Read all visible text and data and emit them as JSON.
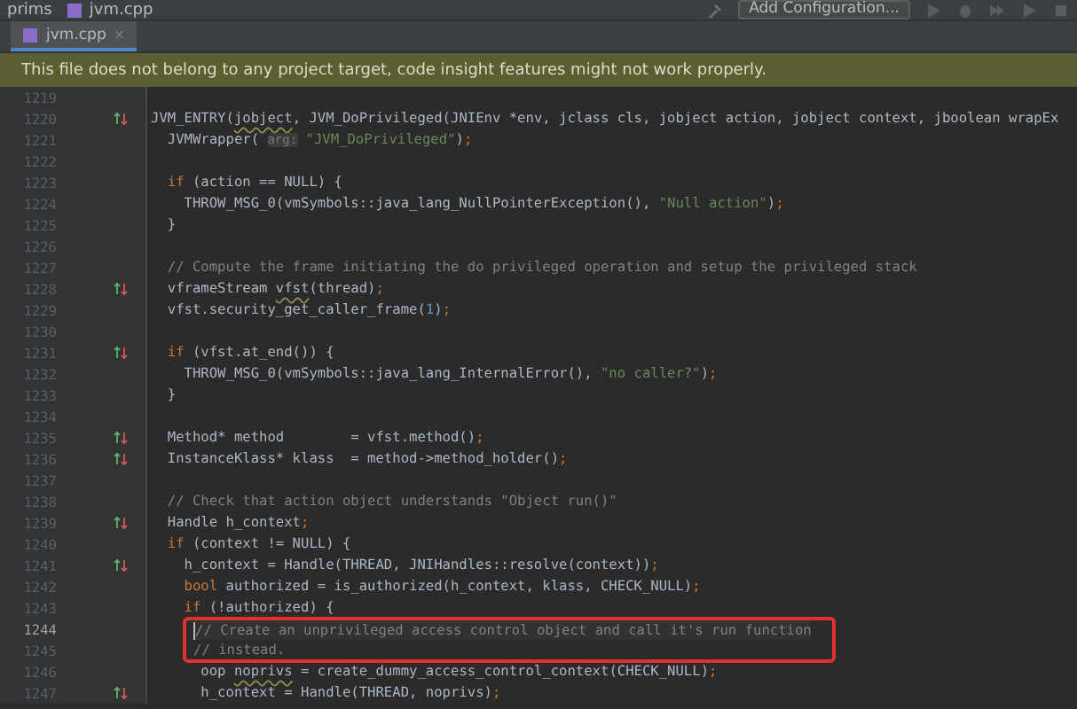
{
  "breadcrumb": [
    "prims",
    "jvm.cpp"
  ],
  "run_config": {
    "label": "Add Configuration..."
  },
  "tabs": [
    {
      "label": "jvm.cpp",
      "close": "×",
      "selected": true
    }
  ],
  "banner": {
    "text": "This file does not belong to any project target, code insight features might not work properly."
  },
  "lines": [
    {
      "number": "1219",
      "gutter_icon": false,
      "current": false,
      "boxed": false
    },
    {
      "number": "1220",
      "gutter_icon": true,
      "current": false,
      "boxed": false,
      "tokens": [
        {
          "kind": "plain",
          "text": "JVM_ENTRY("
        },
        {
          "kind": "warn",
          "text": "jobject"
        },
        {
          "kind": "plain",
          "text": ", JVM_DoPrivileged(JNIEnv *env, jclass cls, jobject action, jobject context, jboolean wrapEx"
        }
      ]
    },
    {
      "number": "1221",
      "gutter_icon": false,
      "current": false,
      "boxed": false,
      "tokens": [
        {
          "kind": "plain",
          "text": "  JVMWrapper( "
        },
        {
          "kind": "hint",
          "text": "arg:"
        },
        {
          "kind": "str",
          "text": " \"JVM_DoPrivileged\""
        },
        {
          "kind": "plain",
          "text": ")"
        },
        {
          "kind": "punct",
          "text": ";"
        }
      ]
    },
    {
      "number": "1222",
      "gutter_icon": false,
      "current": false,
      "boxed": false
    },
    {
      "number": "1223",
      "gutter_icon": false,
      "current": false,
      "boxed": false,
      "tokens": [
        {
          "kind": "kw",
          "text": "  if"
        },
        {
          "kind": "plain",
          "text": " (action == NULL) {"
        }
      ]
    },
    {
      "number": "1224",
      "gutter_icon": false,
      "current": false,
      "boxed": false,
      "tokens": [
        {
          "kind": "plain",
          "text": "    THROW_MSG_0(vmSymbols::java_lang_NullPointerException(), "
        },
        {
          "kind": "str",
          "text": "\"Null action\""
        },
        {
          "kind": "plain",
          "text": ")"
        },
        {
          "kind": "punct",
          "text": ";"
        }
      ]
    },
    {
      "number": "1225",
      "gutter_icon": false,
      "current": false,
      "boxed": false,
      "tokens": [
        {
          "kind": "plain",
          "text": "  }"
        }
      ]
    },
    {
      "number": "1226",
      "gutter_icon": false,
      "current": false,
      "boxed": false
    },
    {
      "number": "1227",
      "gutter_icon": false,
      "current": false,
      "boxed": false,
      "tokens": [
        {
          "kind": "cmt",
          "text": "  // Compute the frame initiating the do privileged operation and setup the privileged stack"
        }
      ]
    },
    {
      "number": "1228",
      "gutter_icon": true,
      "current": false,
      "boxed": false,
      "tokens": [
        {
          "kind": "plain",
          "text": "  vframeStream "
        },
        {
          "kind": "warn",
          "text": "vfst"
        },
        {
          "kind": "plain",
          "text": "(thread)"
        },
        {
          "kind": "punct",
          "text": ";"
        }
      ]
    },
    {
      "number": "1229",
      "gutter_icon": false,
      "current": false,
      "boxed": false,
      "tokens": [
        {
          "kind": "plain",
          "text": "  vfst.security_get_caller_frame("
        },
        {
          "kind": "num",
          "text": "1"
        },
        {
          "kind": "plain",
          "text": ")"
        },
        {
          "kind": "punct",
          "text": ";"
        }
      ]
    },
    {
      "number": "1230",
      "gutter_icon": false,
      "current": false,
      "boxed": false
    },
    {
      "number": "1231",
      "gutter_icon": true,
      "current": false,
      "boxed": false,
      "tokens": [
        {
          "kind": "kw",
          "text": "  if"
        },
        {
          "kind": "plain",
          "text": " (vfst.at_end()) {"
        }
      ]
    },
    {
      "number": "1232",
      "gutter_icon": false,
      "current": false,
      "boxed": false,
      "tokens": [
        {
          "kind": "plain",
          "text": "    THROW_MSG_0(vmSymbols::java_lang_InternalError(), "
        },
        {
          "kind": "str",
          "text": "\"no caller?\""
        },
        {
          "kind": "plain",
          "text": ")"
        },
        {
          "kind": "punct",
          "text": ";"
        }
      ]
    },
    {
      "number": "1233",
      "gutter_icon": false,
      "current": false,
      "boxed": false,
      "tokens": [
        {
          "kind": "plain",
          "text": "  }"
        }
      ]
    },
    {
      "number": "1234",
      "gutter_icon": false,
      "current": false,
      "boxed": false
    },
    {
      "number": "1235",
      "gutter_icon": true,
      "current": false,
      "boxed": false,
      "tokens": [
        {
          "kind": "plain",
          "text": "  Method* method        = vfst.method()"
        },
        {
          "kind": "punct",
          "text": ";"
        }
      ]
    },
    {
      "number": "1236",
      "gutter_icon": true,
      "current": false,
      "boxed": false,
      "tokens": [
        {
          "kind": "plain",
          "text": "  InstanceKlass* klass  = method->method_holder()"
        },
        {
          "kind": "punct",
          "text": ";"
        }
      ]
    },
    {
      "number": "1237",
      "gutter_icon": false,
      "current": false,
      "boxed": false
    },
    {
      "number": "1238",
      "gutter_icon": false,
      "current": false,
      "boxed": false,
      "tokens": [
        {
          "kind": "cmt",
          "text": "  // Check that action object understands \"Object run()\""
        }
      ]
    },
    {
      "number": "1239",
      "gutter_icon": true,
      "current": false,
      "boxed": false,
      "tokens": [
        {
          "kind": "plain",
          "text": "  Handle h_context"
        },
        {
          "kind": "punct",
          "text": ";"
        }
      ]
    },
    {
      "number": "1240",
      "gutter_icon": false,
      "current": false,
      "boxed": false,
      "tokens": [
        {
          "kind": "kw",
          "text": "  if"
        },
        {
          "kind": "plain",
          "text": " (context != NULL) {"
        }
      ]
    },
    {
      "number": "1241",
      "gutter_icon": true,
      "current": false,
      "boxed": false,
      "tokens": [
        {
          "kind": "plain",
          "text": "    h_context = Handle(THREAD, JNIHandles::resolve(context))"
        },
        {
          "kind": "punct",
          "text": ";"
        }
      ]
    },
    {
      "number": "1242",
      "gutter_icon": false,
      "current": false,
      "boxed": false,
      "tokens": [
        {
          "kind": "kw",
          "text": "    bool"
        },
        {
          "kind": "plain",
          "text": " authorized = is_authorized(h_context, klass, CHECK_NULL)"
        },
        {
          "kind": "punct",
          "text": ";"
        }
      ]
    },
    {
      "number": "1243",
      "gutter_icon": false,
      "current": false,
      "boxed": false,
      "tokens": [
        {
          "kind": "kw",
          "text": "    if"
        },
        {
          "kind": "plain",
          "text": " (!authorized) {"
        }
      ]
    },
    {
      "number": "1244",
      "gutter_icon": false,
      "current": true,
      "boxed": true,
      "tokens": [
        {
          "kind": "cmt",
          "text": "// Create an unprivileged access control object and call it's run function"
        }
      ]
    },
    {
      "number": "1245",
      "gutter_icon": false,
      "current": false,
      "boxed": true,
      "tokens": [
        {
          "kind": "cmt",
          "text": "// instead."
        }
      ]
    },
    {
      "number": "1246",
      "gutter_icon": false,
      "current": false,
      "boxed": false,
      "tokens": [
        {
          "kind": "plain",
          "text": "      oop "
        },
        {
          "kind": "warn",
          "text": "noprivs"
        },
        {
          "kind": "plain",
          "text": " = create_dummy_access_control_context(CHECK_NULL)"
        },
        {
          "kind": "punct",
          "text": ";"
        }
      ]
    },
    {
      "number": "1247",
      "gutter_icon": true,
      "current": false,
      "boxed": false,
      "tokens": [
        {
          "kind": "plain",
          "text": "      h_context = Handle(THREAD, noprivs)"
        },
        {
          "kind": "punct",
          "text": ";"
        }
      ]
    }
  ]
}
